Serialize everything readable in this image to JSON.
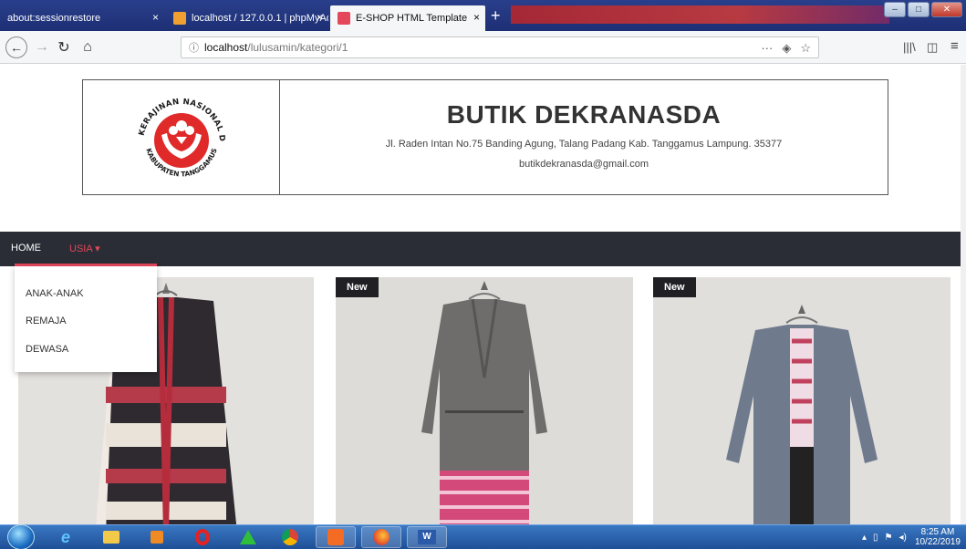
{
  "browser": {
    "tabs": [
      {
        "label": "about:sessionrestore",
        "close": "×"
      },
      {
        "label": "localhost / 127.0.0.1 | phpMyAd",
        "close": "×"
      },
      {
        "label": "E-SHOP HTML Template",
        "close": "×"
      }
    ],
    "new_tab": "+",
    "url_host": "localhost",
    "url_path": "/lulusamin/kategori/1",
    "icons": [
      "back-icon",
      "forward-icon",
      "reload-icon",
      "home-icon",
      "info-icon",
      "more-icon",
      "pocket-icon",
      "bookmark-star-icon",
      "library-icon",
      "sidebar-icon",
      "hamburger-menu-icon"
    ]
  },
  "header": {
    "title": "BUTIK DEKRANASDA",
    "address": "Jl. Raden Intan No.75 Banding Agung, Talang Padang Kab. Tanggamus Lampung. 35377",
    "email": "butikdekranasda@gmail.com",
    "logo_text_top": "DEWAN KERAJINAN NASIONAL DAERAH",
    "logo_text_bottom": "KABUPATEN TANGGAMUS"
  },
  "nav": {
    "home": "HOME",
    "usia": "USIA",
    "dropdown": [
      "ANAK-ANAK",
      "REMAJA",
      "DEWASA"
    ]
  },
  "products": [
    {
      "badge": ""
    },
    {
      "badge": "New"
    },
    {
      "badge": "New"
    }
  ],
  "taskbar": {
    "apps": [
      "ie-icon",
      "explorer-icon",
      "media-icon",
      "opera-icon",
      "app-icon",
      "chrome-icon",
      "xampp-icon",
      "firefox-icon",
      "word-icon"
    ],
    "time": "8:25 AM",
    "date": "10/22/2019"
  },
  "colors": {
    "accent": "#e4465a",
    "nav_bg": "#2b2d36",
    "badge_bg": "#1f1f24",
    "logo_red": "#e02a2a"
  }
}
